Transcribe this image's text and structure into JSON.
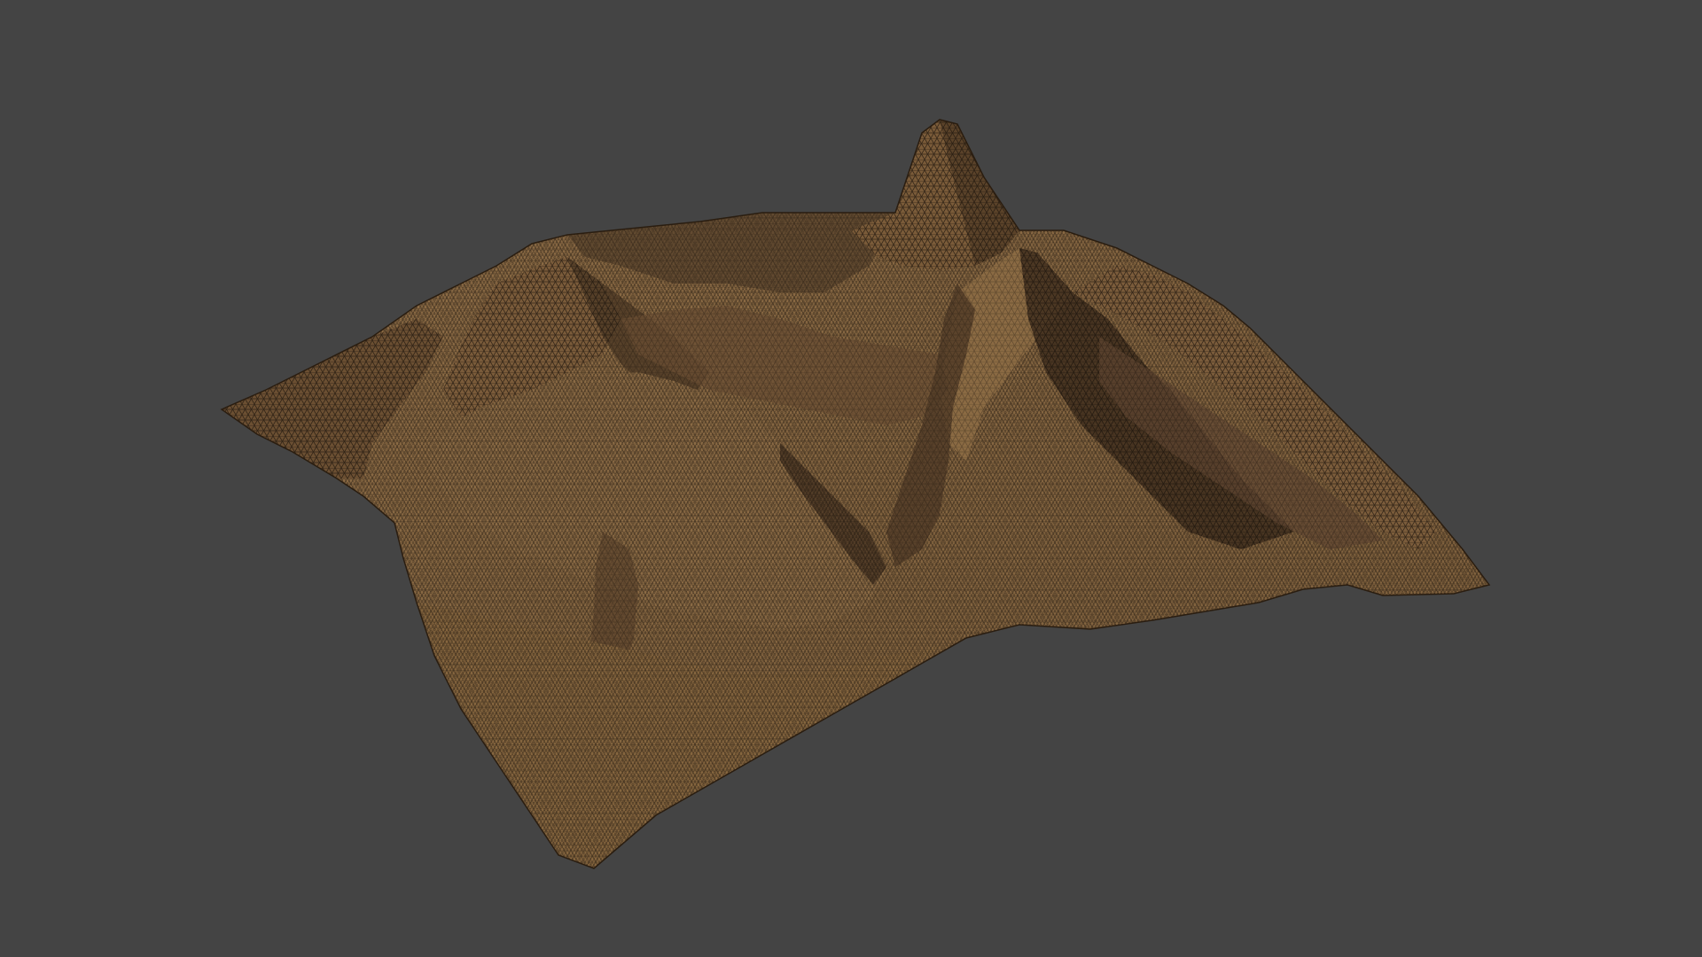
{
  "viewport": {
    "background_color": "#444444"
  },
  "terrain_mesh": {
    "render_mode": "shaded-wireframe",
    "base_color": "#8a6a44",
    "shadow_color": "#3a2b1c",
    "highlight_color": "#a07d53",
    "wire_color": "#1a120a"
  }
}
